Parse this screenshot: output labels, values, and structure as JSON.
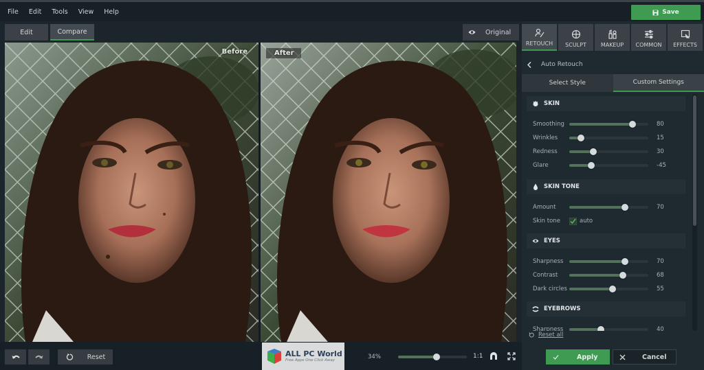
{
  "menu": {
    "items": [
      "File",
      "Edit",
      "Tools",
      "View",
      "Help"
    ],
    "save_label": "Save"
  },
  "mode_tabs": [
    {
      "label": "Edit",
      "active": false
    },
    {
      "label": "Compare",
      "active": true
    }
  ],
  "original_label": "Original",
  "compare": {
    "before_label": "Before",
    "after_label": "After"
  },
  "tool_tabs": [
    {
      "label": "RETOUCH",
      "icon": "retouch-icon",
      "active": true
    },
    {
      "label": "SCULPT",
      "icon": "sculpt-icon",
      "active": false
    },
    {
      "label": "MAKEUP",
      "icon": "makeup-icon",
      "active": false
    },
    {
      "label": "COMMON",
      "icon": "sliders-icon",
      "active": false
    },
    {
      "label": "EFFECTS",
      "icon": "effects-icon",
      "active": false
    }
  ],
  "panel": {
    "back_title": "Auto Retouch",
    "subtabs": [
      {
        "label": "Select Style",
        "active": false
      },
      {
        "label": "Custom Settings",
        "active": true
      }
    ],
    "sections": {
      "skin": {
        "title": "SKIN",
        "sliders": [
          {
            "label": "Smoothing",
            "value": 80,
            "min": 0,
            "max": 100
          },
          {
            "label": "Wrinkles",
            "value": 15,
            "min": 0,
            "max": 100
          },
          {
            "label": "Redness",
            "value": 30,
            "min": 0,
            "max": 100
          },
          {
            "label": "Glare",
            "value": -45,
            "min": -100,
            "max": 100
          }
        ]
      },
      "skin_tone": {
        "title": "SKIN TONE",
        "sliders": [
          {
            "label": "Amount",
            "value": 70,
            "min": 0,
            "max": 100
          }
        ],
        "skin_tone_label": "Skin tone",
        "auto_label": "auto",
        "auto_checked": true
      },
      "eyes": {
        "title": "EYES",
        "sliders": [
          {
            "label": "Sharpness",
            "value": 70,
            "min": 0,
            "max": 100
          },
          {
            "label": "Contrast",
            "value": 68,
            "min": 0,
            "max": 100
          },
          {
            "label": "Dark circles",
            "value": 55,
            "min": 0,
            "max": 100
          }
        ]
      },
      "eyebrows": {
        "title": "EYEBROWS",
        "sliders": [
          {
            "label": "Sharpness",
            "value": 40,
            "min": 0,
            "max": 100
          }
        ]
      }
    },
    "reset_all_label": "Reset all"
  },
  "bottom": {
    "reset_label": "Reset",
    "zoom_value": "34%",
    "zoom_fraction": 0.56,
    "one_to_one": "1:1",
    "apply_label": "Apply",
    "cancel_label": "Cancel"
  },
  "watermark": {
    "title": "ALL PC World",
    "tagline": "Free Apps One Click Away"
  },
  "colors": {
    "accent": "#3f9a52",
    "background": "#1b252b",
    "panel": "#1f2a30"
  }
}
